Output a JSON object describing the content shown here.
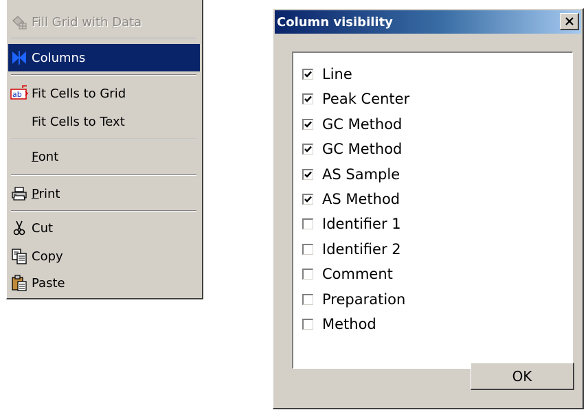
{
  "menu": {
    "items": [
      {
        "label": "Fill Grid with Data",
        "accel": "D",
        "icon": "fill-grid-icon",
        "disabled": true
      },
      {
        "label": "Columns",
        "icon": "columns-icon",
        "selected": true
      },
      {
        "label": "Fit Cells to Grid",
        "icon": "fit-cells-icon"
      },
      {
        "label": "Fit Cells to Text"
      },
      {
        "label": "Font",
        "accel": "F"
      },
      {
        "label": "Print",
        "accel": "P",
        "icon": "printer-icon"
      },
      {
        "label": "Cut",
        "icon": "scissors-icon"
      },
      {
        "label": "Copy",
        "icon": "copy-icon"
      },
      {
        "label": "Paste",
        "icon": "paste-icon"
      }
    ]
  },
  "dialog": {
    "title": "Column visibility",
    "ok_label": "OK",
    "columns": [
      {
        "label": "Line",
        "checked": true
      },
      {
        "label": "Peak Center",
        "checked": true
      },
      {
        "label": "GC Method",
        "checked": true
      },
      {
        "label": "GC Method",
        "checked": true
      },
      {
        "label": "AS Sample",
        "checked": true
      },
      {
        "label": "AS Method",
        "checked": true
      },
      {
        "label": "Identifier 1",
        "checked": false
      },
      {
        "label": "Identifier 2",
        "checked": false
      },
      {
        "label": "Comment",
        "checked": false
      },
      {
        "label": "Preparation",
        "checked": false
      },
      {
        "label": "Method",
        "checked": false
      }
    ]
  },
  "colors": {
    "face": "#d4d0c8",
    "highlight": "#0a246a",
    "disabled_text": "#8d8a85"
  }
}
